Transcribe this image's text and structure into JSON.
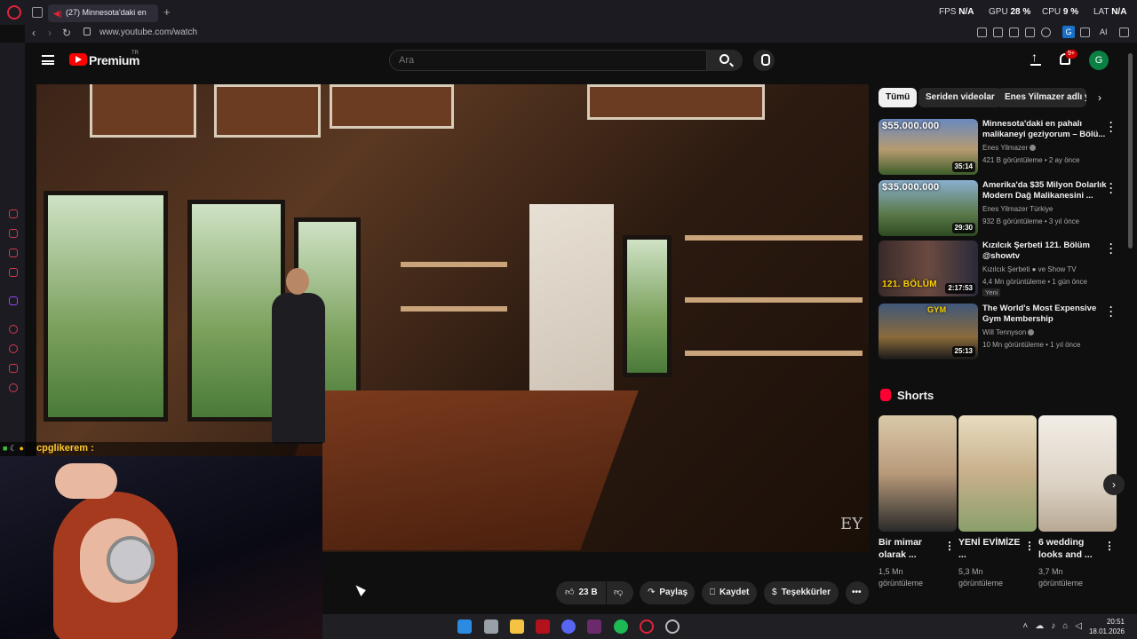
{
  "browser": {
    "tab_title": "(27) Minnesota'daki en",
    "url": "www.youtube.com/watch",
    "stats": {
      "fps_label": "FPS",
      "fps_value": "N/A",
      "gpu_label": "GPU",
      "gpu_value": "28 %",
      "cpu_label": "CPU",
      "cpu_value": "9 %",
      "lat_label": "LAT",
      "lat_value": "N/A"
    },
    "ext_g": "G",
    "ext_ai": "AI"
  },
  "header": {
    "brand": "Premium",
    "country": "TR",
    "search_placeholder": "Ara",
    "notif_count": "9+",
    "avatar_letter": "G"
  },
  "video": {
    "watermark": "EY"
  },
  "chat": {
    "username": "cpglikerem :",
    "message": ""
  },
  "actions": {
    "likes": "23 B",
    "share": "Paylaş",
    "save": "Kaydet",
    "thanks": "Teşekkürler"
  },
  "chips": [
    {
      "label": "Tümü"
    },
    {
      "label": "Seriden videolar"
    },
    {
      "label": "Enes Yilmazer adlı yü"
    }
  ],
  "recommended": [
    {
      "title": "Minnesota'daki en pahalı malikaneyi geziyorum – Bölü...",
      "channel": "Enes Yilmazer",
      "meta": "421 B görüntüleme • 2 ay önce",
      "duration": "35:14",
      "overlay": "$55.000.000",
      "badge": ""
    },
    {
      "title": "Amerika'da $35 Milyon Dolarlık Modern Dağ Malikanesini ...",
      "channel": "Enes Yilmazer Türkiye",
      "meta": "932 B görüntüleme • 3 yıl önce",
      "duration": "29:30",
      "overlay": "$35.000.000",
      "badge": ""
    },
    {
      "title": "Kızılcık Şerbeti 121. Bölüm @showtv",
      "channel": "Kızılcık Şerbeti ● ve Show TV",
      "meta": "4,4 Mn görüntüleme • 1 gün önce",
      "duration": "2:17:53",
      "overlay": "121. BÖLÜM",
      "badge": "Yeni"
    },
    {
      "title": "The World's Most Expensive Gym Membership ($10k/month)",
      "channel": "Will Tennyson",
      "meta": "10 Mn görüntüleme • 1 yıl önce",
      "duration": "25:13",
      "overlay": "GYM",
      "badge": ""
    }
  ],
  "shorts": {
    "heading": "Shorts",
    "items": [
      {
        "title": "Bir mimar olarak ...",
        "views": "1,5 Mn görüntüleme"
      },
      {
        "title": "YENİ EVİMİZE ...",
        "views": "5,3 Mn görüntüleme"
      },
      {
        "title": "6 wedding looks and ...",
        "views": "3,7 Mn görüntüleme"
      }
    ]
  },
  "taskbar": {
    "time": "20:51",
    "date": "18.01.2026"
  }
}
